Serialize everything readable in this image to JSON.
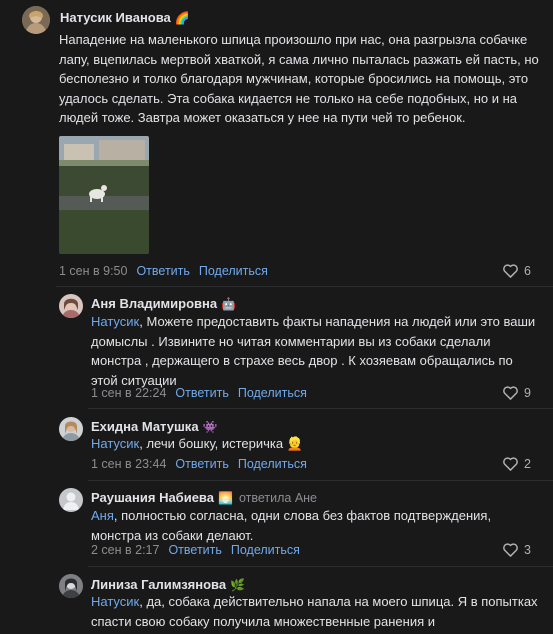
{
  "comments": [
    {
      "author": "Натусик Иванова",
      "author_emoji": "🌈",
      "text": "Нападение на маленького шпица произошло при нас, она разгрызла собачке лапу, вцепилась мертвой хваткой, я сама лично пыталась разжать ей пасть, но бесполезно и толко благодаря мужчинам, которые бросились на помощь, это удалось сделать. Эта собака кидается не только на себе подобных, но и на людей тоже. Завтра может оказаться у нее на пути чей то ребенок.",
      "date": "1 сен в 9:50",
      "reply": "Ответить",
      "share": "Поделиться",
      "likes": "6"
    },
    {
      "author": "Аня Владимировна",
      "author_emoji": "🤖",
      "mention": "Натусик",
      "text": ", Можете предоставить факты нападения на людей или это ваши домыслы . Извините но читая комментарии вы из собаки сделали монстра , держащего в страхе весь двор . К хозяевам обращались по этой ситуации",
      "date": "1 сен в 22:24",
      "reply": "Ответить",
      "share": "Поделиться",
      "likes": "9"
    },
    {
      "author": "Ехидна Матушка",
      "author_emoji": "👾",
      "mention": "Натусик",
      "text": ", лечи бошку, истеричка 👱",
      "date": "1 сен в 23:44",
      "reply": "Ответить",
      "share": "Поделиться",
      "likes": "2"
    },
    {
      "author": "Раушания Набиева",
      "author_emoji": "🌅",
      "replied_to": "ответила Ане",
      "mention": "Аня",
      "text": ", полностью согласна, одни слова без фактов подтверждения, монстра из собаки делают.",
      "date": "2 сен в 2:17",
      "reply": "Ответить",
      "share": "Поделиться",
      "likes": "3"
    },
    {
      "author": "Линиза Галимзянова",
      "author_emoji": "🌿",
      "mention": "Натусик",
      "text": ", да, собака действительно напала на моего шпица. Я в попытках спасти свою собаку получила множественные ранения и"
    }
  ],
  "icons": {
    "like": "heart-icon"
  },
  "colors": {
    "link": "#71aaeb",
    "background": "#19191a"
  }
}
